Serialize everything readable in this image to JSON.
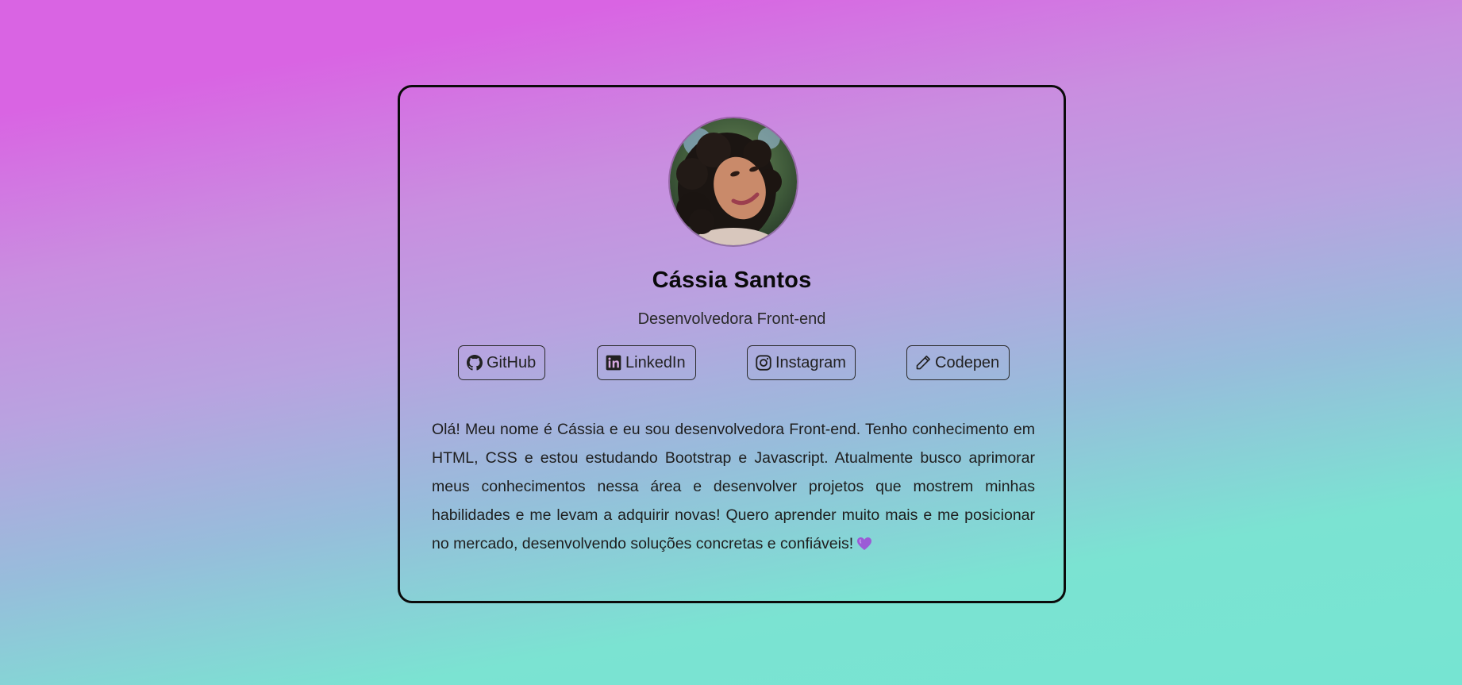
{
  "profile": {
    "name": "Cássia Santos",
    "role": "Desenvolvedora Front-end",
    "avatar_alt": "Foto de Cássia Santos"
  },
  "social_links": [
    {
      "label": "GitHub",
      "icon": "github-icon"
    },
    {
      "label": "LinkedIn",
      "icon": "linkedin-icon"
    },
    {
      "label": "Instagram",
      "icon": "instagram-icon"
    },
    {
      "label": "Codepen",
      "icon": "pencil-icon"
    }
  ],
  "bio": {
    "text": "Olá! Meu nome é Cássia e eu sou desenvolvedora Front-end. Tenho conhecimento em HTML, CSS e estou estudando Bootstrap e Javascript. Atualmente busco aprimorar meus conhecimentos nessa área e desenvolver projetos que mostrem minhas habilidades e me levam a adquirir novas! Quero aprender muito mais e me posicionar no mercado, desenvolvendo soluções concretas e confiáveis!",
    "emoji_icon": "purple-heart-icon"
  },
  "colors": {
    "gradient_top": "#d964e3",
    "gradient_bottom": "#76e4d2",
    "card_border": "#0b0b0b",
    "heart": "#9b5bd6"
  }
}
